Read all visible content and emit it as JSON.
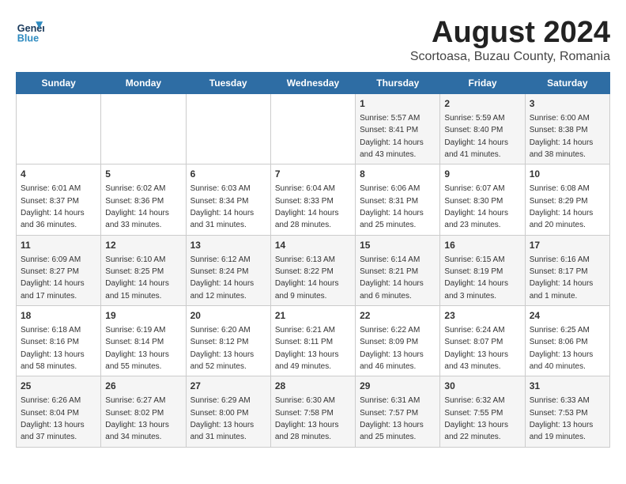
{
  "logo": {
    "line1": "General",
    "line2": "Blue"
  },
  "title": "August 2024",
  "subtitle": "Scortoasa, Buzau County, Romania",
  "days_of_week": [
    "Sunday",
    "Monday",
    "Tuesday",
    "Wednesday",
    "Thursday",
    "Friday",
    "Saturday"
  ],
  "weeks": [
    [
      {
        "day": "",
        "info": ""
      },
      {
        "day": "",
        "info": ""
      },
      {
        "day": "",
        "info": ""
      },
      {
        "day": "",
        "info": ""
      },
      {
        "day": "1",
        "info": "Sunrise: 5:57 AM\nSunset: 8:41 PM\nDaylight: 14 hours\nand 43 minutes."
      },
      {
        "day": "2",
        "info": "Sunrise: 5:59 AM\nSunset: 8:40 PM\nDaylight: 14 hours\nand 41 minutes."
      },
      {
        "day": "3",
        "info": "Sunrise: 6:00 AM\nSunset: 8:38 PM\nDaylight: 14 hours\nand 38 minutes."
      }
    ],
    [
      {
        "day": "4",
        "info": "Sunrise: 6:01 AM\nSunset: 8:37 PM\nDaylight: 14 hours\nand 36 minutes."
      },
      {
        "day": "5",
        "info": "Sunrise: 6:02 AM\nSunset: 8:36 PM\nDaylight: 14 hours\nand 33 minutes."
      },
      {
        "day": "6",
        "info": "Sunrise: 6:03 AM\nSunset: 8:34 PM\nDaylight: 14 hours\nand 31 minutes."
      },
      {
        "day": "7",
        "info": "Sunrise: 6:04 AM\nSunset: 8:33 PM\nDaylight: 14 hours\nand 28 minutes."
      },
      {
        "day": "8",
        "info": "Sunrise: 6:06 AM\nSunset: 8:31 PM\nDaylight: 14 hours\nand 25 minutes."
      },
      {
        "day": "9",
        "info": "Sunrise: 6:07 AM\nSunset: 8:30 PM\nDaylight: 14 hours\nand 23 minutes."
      },
      {
        "day": "10",
        "info": "Sunrise: 6:08 AM\nSunset: 8:29 PM\nDaylight: 14 hours\nand 20 minutes."
      }
    ],
    [
      {
        "day": "11",
        "info": "Sunrise: 6:09 AM\nSunset: 8:27 PM\nDaylight: 14 hours\nand 17 minutes."
      },
      {
        "day": "12",
        "info": "Sunrise: 6:10 AM\nSunset: 8:25 PM\nDaylight: 14 hours\nand 15 minutes."
      },
      {
        "day": "13",
        "info": "Sunrise: 6:12 AM\nSunset: 8:24 PM\nDaylight: 14 hours\nand 12 minutes."
      },
      {
        "day": "14",
        "info": "Sunrise: 6:13 AM\nSunset: 8:22 PM\nDaylight: 14 hours\nand 9 minutes."
      },
      {
        "day": "15",
        "info": "Sunrise: 6:14 AM\nSunset: 8:21 PM\nDaylight: 14 hours\nand 6 minutes."
      },
      {
        "day": "16",
        "info": "Sunrise: 6:15 AM\nSunset: 8:19 PM\nDaylight: 14 hours\nand 3 minutes."
      },
      {
        "day": "17",
        "info": "Sunrise: 6:16 AM\nSunset: 8:17 PM\nDaylight: 14 hours\nand 1 minute."
      }
    ],
    [
      {
        "day": "18",
        "info": "Sunrise: 6:18 AM\nSunset: 8:16 PM\nDaylight: 13 hours\nand 58 minutes."
      },
      {
        "day": "19",
        "info": "Sunrise: 6:19 AM\nSunset: 8:14 PM\nDaylight: 13 hours\nand 55 minutes."
      },
      {
        "day": "20",
        "info": "Sunrise: 6:20 AM\nSunset: 8:12 PM\nDaylight: 13 hours\nand 52 minutes."
      },
      {
        "day": "21",
        "info": "Sunrise: 6:21 AM\nSunset: 8:11 PM\nDaylight: 13 hours\nand 49 minutes."
      },
      {
        "day": "22",
        "info": "Sunrise: 6:22 AM\nSunset: 8:09 PM\nDaylight: 13 hours\nand 46 minutes."
      },
      {
        "day": "23",
        "info": "Sunrise: 6:24 AM\nSunset: 8:07 PM\nDaylight: 13 hours\nand 43 minutes."
      },
      {
        "day": "24",
        "info": "Sunrise: 6:25 AM\nSunset: 8:06 PM\nDaylight: 13 hours\nand 40 minutes."
      }
    ],
    [
      {
        "day": "25",
        "info": "Sunrise: 6:26 AM\nSunset: 8:04 PM\nDaylight: 13 hours\nand 37 minutes."
      },
      {
        "day": "26",
        "info": "Sunrise: 6:27 AM\nSunset: 8:02 PM\nDaylight: 13 hours\nand 34 minutes."
      },
      {
        "day": "27",
        "info": "Sunrise: 6:29 AM\nSunset: 8:00 PM\nDaylight: 13 hours\nand 31 minutes."
      },
      {
        "day": "28",
        "info": "Sunrise: 6:30 AM\nSunset: 7:58 PM\nDaylight: 13 hours\nand 28 minutes."
      },
      {
        "day": "29",
        "info": "Sunrise: 6:31 AM\nSunset: 7:57 PM\nDaylight: 13 hours\nand 25 minutes."
      },
      {
        "day": "30",
        "info": "Sunrise: 6:32 AM\nSunset: 7:55 PM\nDaylight: 13 hours\nand 22 minutes."
      },
      {
        "day": "31",
        "info": "Sunrise: 6:33 AM\nSunset: 7:53 PM\nDaylight: 13 hours\nand 19 minutes."
      }
    ]
  ]
}
